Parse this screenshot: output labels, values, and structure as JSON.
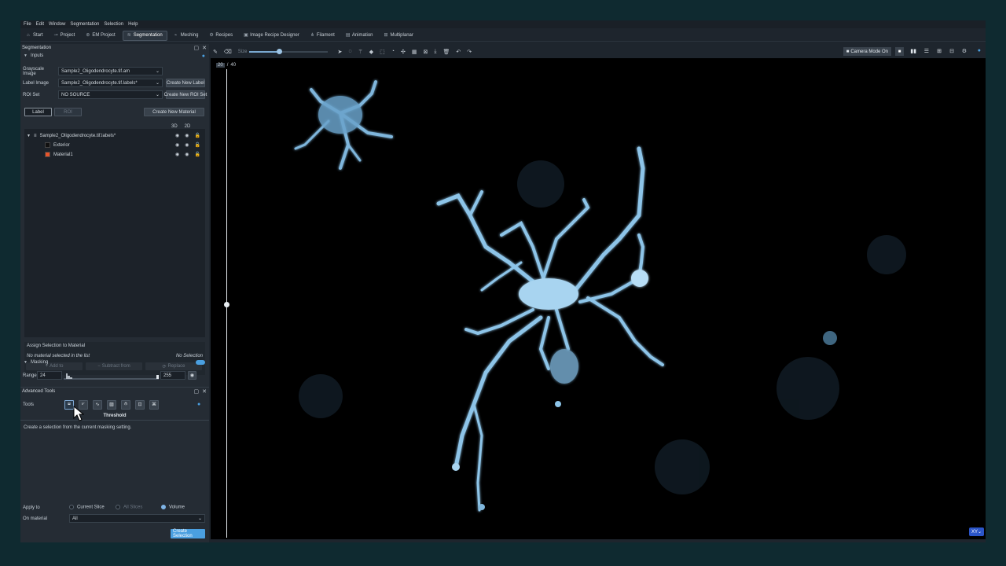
{
  "menu": [
    "File",
    "Edit",
    "Window",
    "Segmentation",
    "Selection",
    "Help"
  ],
  "tabs": [
    {
      "label": "Start",
      "icon": "home-icon",
      "active": false
    },
    {
      "label": "Project",
      "icon": "project-icon",
      "active": false
    },
    {
      "label": "EM Project",
      "icon": "em-project-icon",
      "active": false
    },
    {
      "label": "Segmentation",
      "icon": "segmentation-icon",
      "active": true
    },
    {
      "label": "Meshing",
      "icon": "meshing-icon",
      "active": false
    },
    {
      "label": "Recipes",
      "icon": "recipes-icon",
      "active": false
    },
    {
      "label": "Image Recipe Designer",
      "icon": "recipe-designer-icon",
      "active": false
    },
    {
      "label": "Filament",
      "icon": "filament-icon",
      "active": false
    },
    {
      "label": "Animation",
      "icon": "animation-icon",
      "active": false
    },
    {
      "label": "Multiplanar",
      "icon": "multiplanar-icon",
      "active": false
    }
  ],
  "segmentation_panel": {
    "title": "Segmentation",
    "inputs_header": "Inputs",
    "grayscale_label": "Grayscale Image",
    "grayscale_value": "Sample2_Oligodendrocyte.tif.am",
    "label_image_label": "Label Image",
    "label_image_value": "Sample2_Oligodendrocyte.tif.labels*",
    "create_new_label": "Create New Label",
    "roi_label": "ROI Set",
    "roi_value": "NO SOURCE",
    "create_new_roi": "Create New ROI Set",
    "tab_label": "Label",
    "tab_roi": "ROI",
    "create_new_material": "Create New Material",
    "col_3d": "3D",
    "col_2d": "2D",
    "tree": {
      "root": "Sample2_Oligodendrocyte.tif.labels*",
      "materials": [
        {
          "name": "Exterior",
          "color": "#111111"
        },
        {
          "name": "Material1",
          "color": "#e8542a"
        }
      ]
    },
    "assign_header": "Assign Selection to Material",
    "no_material_text": "No material selected in the list",
    "no_selection_text": "No Selection",
    "add_to": "Add to",
    "subtract_from": "Subtract from",
    "replace": "Replace",
    "masking_header": "Masking",
    "range_label": "Range",
    "range_min": "24",
    "range_max": "255"
  },
  "advanced_tools": {
    "title": "Advanced Tools",
    "tools_label": "Tools",
    "tool_icons": [
      "threshold-icon",
      "mountain-icon",
      "curve-icon",
      "hatch-icon",
      "split-icon",
      "crop-icon",
      "wrap-icon"
    ],
    "tool_name": "Threshold",
    "description": "Create a selection from the current masking setting.",
    "apply_to_label": "Apply to",
    "apply_options": [
      {
        "label": "Current Slice",
        "selected": false
      },
      {
        "label": "All Slices",
        "selected": false
      },
      {
        "label": "Volume",
        "selected": true
      }
    ],
    "on_material_label": "On material",
    "on_material_value": "All",
    "create_selection": "Create Selection"
  },
  "viewer_toolbar": {
    "size_label": "Size",
    "camera_mode": "Camera Mode On"
  },
  "viewer": {
    "slice_current": "20",
    "slice_total": "40",
    "view_label": "XY"
  },
  "colors": {
    "accent": "#4a9fe0",
    "cell": "#a8d4f0"
  }
}
